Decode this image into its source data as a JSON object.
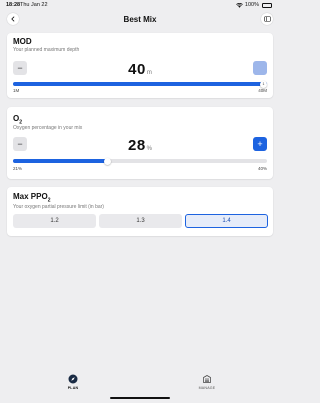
{
  "status": {
    "time": "18:28",
    "date": "Thu Jan 22",
    "battery": "100%"
  },
  "nav": {
    "title": "Best Mix"
  },
  "mod": {
    "title": "MOD",
    "subtitle": "Your planned maximum depth",
    "value": "40",
    "unit": "m",
    "min_label": "1M",
    "max_label": "40M",
    "thumb_value": "1",
    "fraction": 1.0
  },
  "o2": {
    "title_main": "O",
    "title_sub": "2",
    "subtitle": "Oxygen percentage in your mix",
    "value": "28",
    "unit": "%",
    "min_label": "21%",
    "max_label": "40%",
    "fraction": 0.37,
    "minus": "−",
    "plus": "+"
  },
  "ppo2": {
    "title_main": "Max PPO",
    "title_sub": "2",
    "subtitle": "Your oxygen partial pressure limit (in bar)",
    "options": [
      "1.2",
      "1.3",
      "1.4"
    ],
    "selected": "1.4"
  },
  "tabs": [
    {
      "label": "PLAN",
      "icon": "compass-icon",
      "active": true
    },
    {
      "label": "MANAGE",
      "icon": "storage-icon",
      "active": false
    }
  ],
  "colors": {
    "accent": "#1d63e0",
    "background": "#eeeef0"
  }
}
